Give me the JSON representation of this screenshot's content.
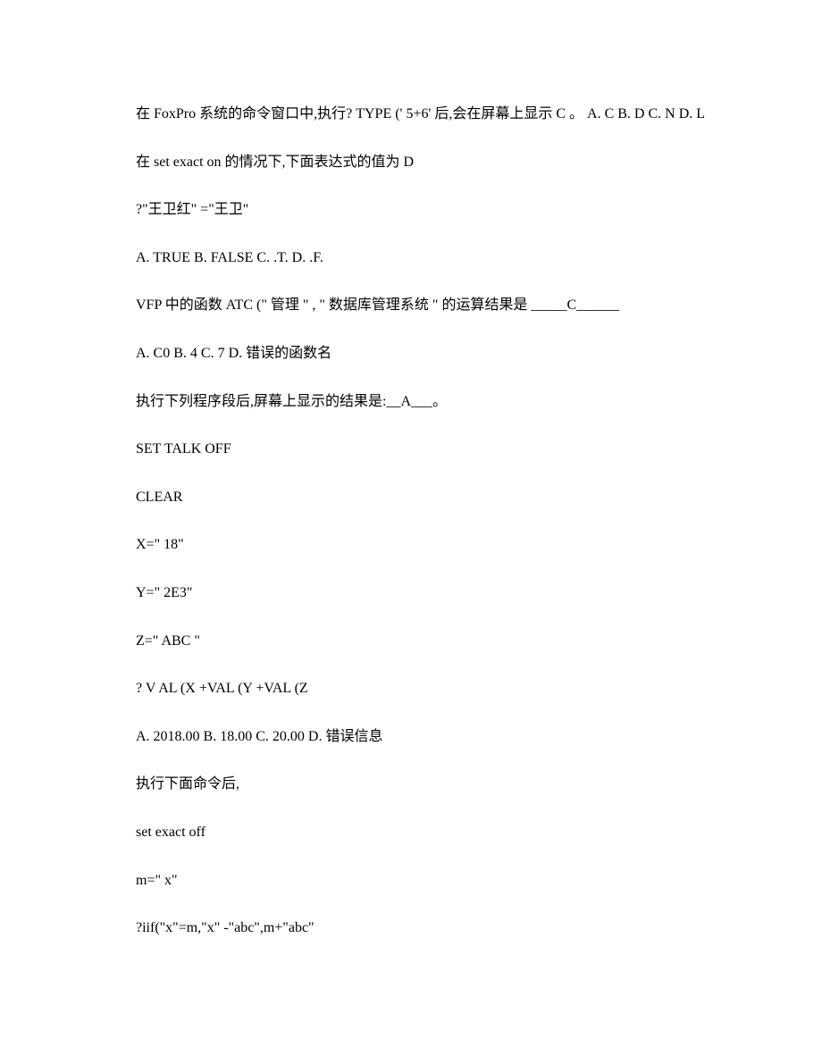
{
  "lines": [
    {
      "text": "在 FoxPro 系统的命令窗口中,执行? TYPE (' 5+6' 后,会在屏幕上显示 C 。 A. C B. D C. N D. L",
      "indent": true
    },
    {
      "text": "在 set exact on 的情况下,下面表达式的值为 D",
      "indent": true
    },
    {
      "text": "?\"王卫红\" =\"王卫\"",
      "indent": true
    },
    {
      "text": "A. TRUE B. FALSE C. .T. D. .F.",
      "indent": true
    },
    {
      "text": "VFP 中的函数 ATC (\" 管理 \" , \" 数据库管理系统 \" 的运算结果是 _____C______",
      "indent": true
    },
    {
      "text": "A. C0 B. 4 C. 7 D. 错误的函数名",
      "indent": true
    },
    {
      "text": "执行下列程序段后,屏幕上显示的结果是:__A___。",
      "indent": true
    },
    {
      "text": "SET TALK OFF",
      "indent": true
    },
    {
      "text": "CLEAR",
      "indent": true
    },
    {
      "text": "X=\" 18\"",
      "indent": true
    },
    {
      "text": "Y=\" 2E3\"",
      "indent": true
    },
    {
      "text": "Z=\" ABC \"",
      "indent": true
    },
    {
      "text": "? V AL (X +VAL (Y +VAL (Z",
      "indent": true
    },
    {
      "text": "A. 2018.00 B. 18.00 C. 20.00 D. 错误信息",
      "indent": true
    },
    {
      "text": "执行下面命令后,",
      "indent": true
    },
    {
      "text": "set exact off",
      "indent": true
    },
    {
      "text": "m=\" x\"",
      "indent": true
    },
    {
      "text": "?iif(\"x\"=m,\"x\" -\"abc\",m+\"abc\"",
      "indent": true
    }
  ]
}
